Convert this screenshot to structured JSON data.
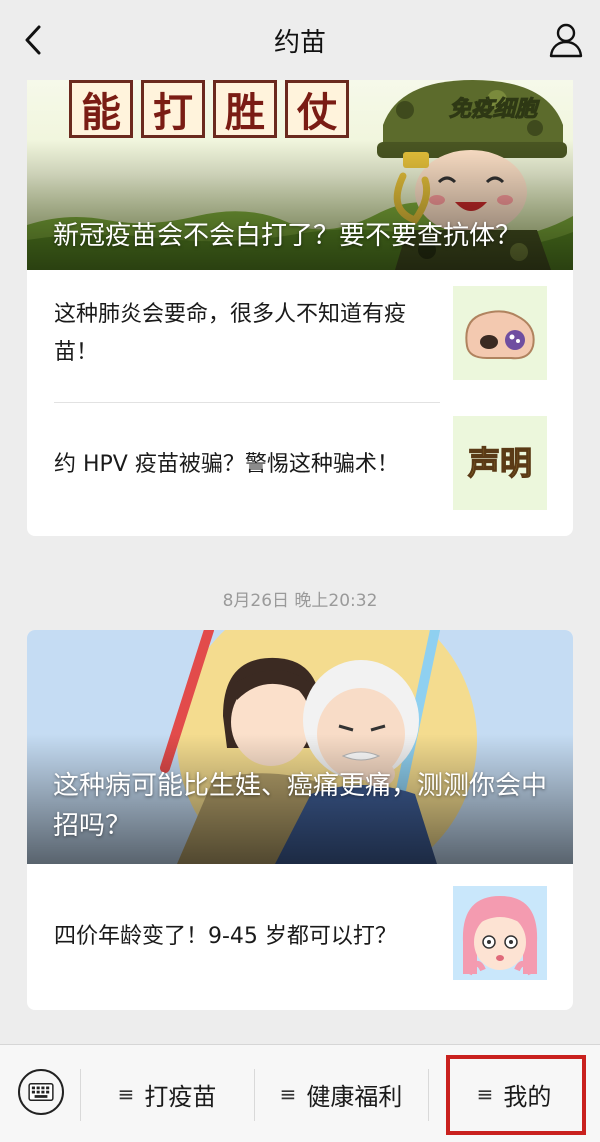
{
  "nav": {
    "title": "约苗",
    "back_icon": "chevron-left-icon",
    "user_icon": "person-icon"
  },
  "card1": {
    "cover": {
      "poster_chars": [
        "能",
        "打",
        "胜",
        "仗"
      ],
      "badge_text": "免疫细胞",
      "title": "新冠疫苗会不会白打了？要不要查抗体？"
    },
    "articles": [
      {
        "title": "这种肺炎会要命，很多人不知道有疫苗！",
        "thumb_icon": "nose-icon"
      },
      {
        "title": "约 HPV 疫苗被骗？警惕这种骗术！",
        "thumb_text": "声明"
      }
    ]
  },
  "timestamp": "8月26日 晚上20:32",
  "card2": {
    "cover": {
      "title": "这种病可能比生娃、癌痛更痛，测测你会中招吗？"
    },
    "articles": [
      {
        "title": "四价年龄变了！9-45 岁都可以打？",
        "thumb_icon": "girl-face-icon"
      }
    ]
  },
  "bottom_menu": {
    "keyboard_icon": "keyboard-icon",
    "menu_icon": "≡",
    "items": [
      "打疫苗",
      "健康福利",
      "我的"
    ],
    "highlight_color": "#c9211e"
  }
}
